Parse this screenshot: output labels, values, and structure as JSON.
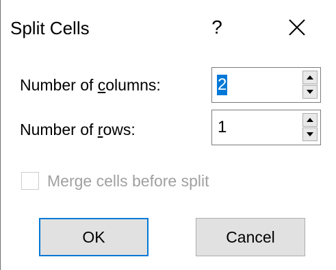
{
  "dialog": {
    "title": "Split Cells",
    "help_label": "?",
    "close_icon": "close-icon"
  },
  "columns": {
    "label": "Number of columns:",
    "label_underline_char": "c",
    "value": "2"
  },
  "rows": {
    "label": "Number of rows:",
    "label_underline_char": "r",
    "value": "1"
  },
  "merge": {
    "label": "Merge cells before split",
    "checked": false,
    "enabled": false
  },
  "buttons": {
    "ok_label": "OK",
    "cancel_label": "Cancel"
  },
  "colors": {
    "accent": "#0078d7",
    "disabled_text": "#a0a0a0",
    "button_face": "#e1e1e1"
  }
}
